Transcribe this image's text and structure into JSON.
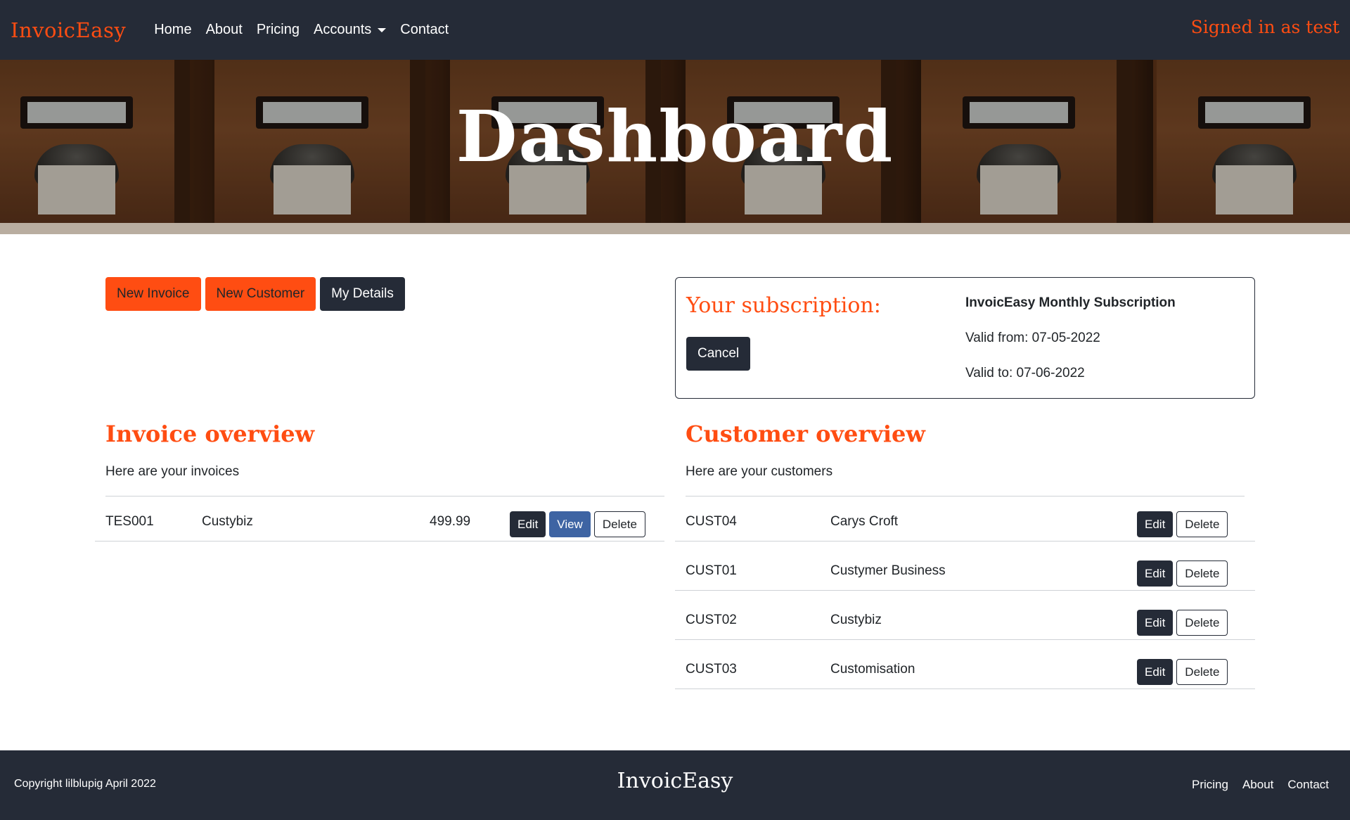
{
  "navbar": {
    "brand": "InvoicEasy",
    "links": [
      "Home",
      "About",
      "Pricing",
      "Accounts",
      "Contact"
    ],
    "signed_in": "Signed in as test"
  },
  "hero": {
    "title": "Dashboard"
  },
  "actions": {
    "new_invoice": "New Invoice",
    "new_customer": "New Customer",
    "my_details": "My Details"
  },
  "subscription": {
    "title": "Your subscription:",
    "cancel": "Cancel",
    "plan_name": "InvoicEasy Monthly Subscription",
    "valid_from": "Valid from: 07-05-2022",
    "valid_to": "Valid to: 07-06-2022"
  },
  "invoices": {
    "title": "Invoice overview",
    "subtitle": "Here are your invoices",
    "rows": [
      {
        "id": "TES001",
        "customer": "Custybiz",
        "amount": "499.99",
        "edit": "Edit",
        "view": "View",
        "delete": "Delete"
      }
    ]
  },
  "customers": {
    "title": "Customer overview",
    "subtitle": "Here are your customers",
    "rows": [
      {
        "id": "CUST04",
        "name": "Carys Croft",
        "edit": "Edit",
        "delete": "Delete"
      },
      {
        "id": "CUST01",
        "name": "Custymer Business",
        "edit": "Edit",
        "delete": "Delete"
      },
      {
        "id": "CUST02",
        "name": "Custybiz",
        "edit": "Edit",
        "delete": "Delete"
      },
      {
        "id": "CUST03",
        "name": "Customisation",
        "edit": "Edit",
        "delete": "Delete"
      }
    ]
  },
  "footer": {
    "copyright": "Copyright lilblupig April 2022",
    "brand": "InvoicEasy",
    "links": [
      "Pricing",
      "About",
      "Contact"
    ]
  },
  "colors": {
    "accent": "#ff4d12",
    "dark": "#252b37",
    "blue": "#3e64a3"
  }
}
